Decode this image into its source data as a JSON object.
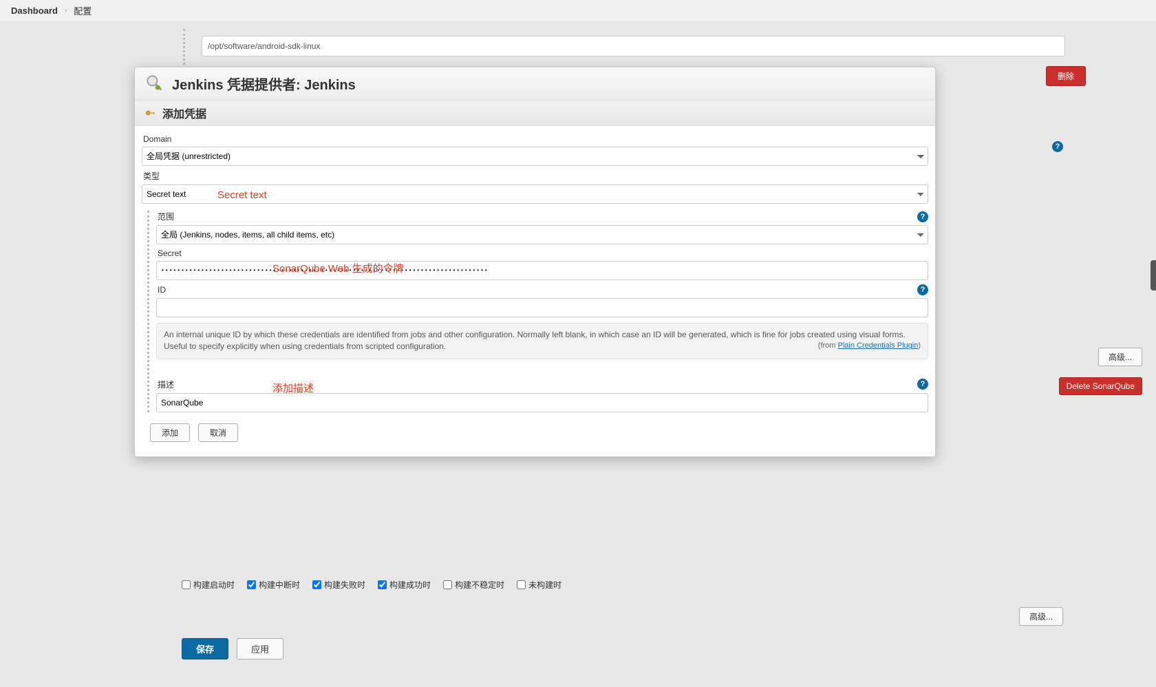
{
  "breadcrumb": {
    "home": "Dashboard",
    "current": "配置"
  },
  "background": {
    "android_sdk_path": "/opt/software/android-sdk-linux",
    "delete_btn": "删除",
    "advanced_btn": "高级...",
    "delete_sonarqube_btn": "Delete SonarQube",
    "save_btn": "保存",
    "apply_btn": "应用",
    "checkboxes": {
      "build_start": "构建启动时",
      "build_abort": "构建中断时",
      "build_fail": "构建失败时",
      "build_success": "构建成功时",
      "build_unstable": "构建不稳定时",
      "not_built": "未构建时"
    }
  },
  "modal": {
    "title": "Jenkins 凭据提供者: Jenkins",
    "subhead": "添加凭据",
    "domain_label": "Domain",
    "domain_value": "全局凭据 (unrestricted)",
    "type_label": "类型",
    "type_value": "Secret text",
    "scope_label": "范围",
    "scope_value": "全局 (Jenkins, nodes, items, all child items, etc)",
    "secret_label": "Secret",
    "secret_value": "••••••••••••••••••••••••••••••••••••••••••••••••••••••••••••••••••••••••••••••••••",
    "id_label": "ID",
    "id_value": "",
    "id_help": "An internal unique ID by which these credentials are identified from jobs and other configuration. Normally left blank, in which case an ID will be generated, which is fine for jobs created using visual forms. Useful to specify explicitly when using credentials from scripted configuration.",
    "id_help_from_prefix": "(from ",
    "id_help_plugin": "Plain Credentials Plugin",
    "id_help_from_suffix": ")",
    "desc_label": "描述",
    "desc_value": "SonarQube",
    "add_btn": "添加",
    "cancel_btn": "取消"
  },
  "annotations": {
    "secret_text": "Secret text",
    "sonar_token": "SonarQube Web 生成的令牌",
    "add_desc": "添加描述"
  }
}
